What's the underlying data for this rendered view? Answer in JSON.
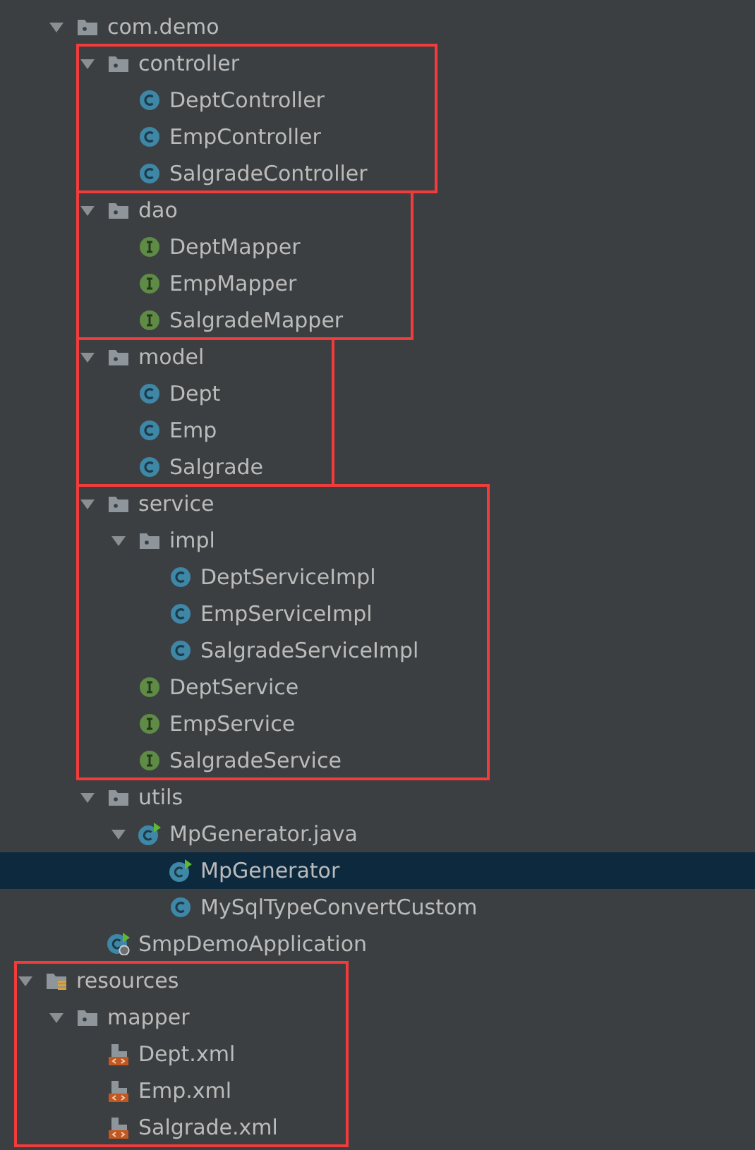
{
  "tree": {
    "continued": [
      {
        "label": "com.demo",
        "kind": "package",
        "expanded": true,
        "selected": false,
        "highlighted": false,
        "children": [
          {
            "label": "controller",
            "kind": "package",
            "expanded": true,
            "selected": false,
            "highlighted": true,
            "children": [
              {
                "label": "DeptController",
                "kind": "class",
                "selected": false
              },
              {
                "label": "EmpController",
                "kind": "class",
                "selected": false
              },
              {
                "label": "SalgradeController",
                "kind": "class",
                "selected": false
              }
            ]
          },
          {
            "label": "dao",
            "kind": "package",
            "expanded": true,
            "selected": false,
            "highlighted": true,
            "children": [
              {
                "label": "DeptMapper",
                "kind": "interface",
                "selected": false
              },
              {
                "label": "EmpMapper",
                "kind": "interface",
                "selected": false
              },
              {
                "label": "SalgradeMapper",
                "kind": "interface",
                "selected": false
              }
            ]
          },
          {
            "label": "model",
            "kind": "package",
            "expanded": true,
            "selected": false,
            "highlighted": true,
            "children": [
              {
                "label": "Dept",
                "kind": "class",
                "selected": false
              },
              {
                "label": "Emp",
                "kind": "class",
                "selected": false
              },
              {
                "label": "Salgrade",
                "kind": "class",
                "selected": false
              }
            ]
          },
          {
            "label": "service",
            "kind": "package",
            "expanded": true,
            "selected": false,
            "highlighted": true,
            "children": [
              {
                "label": "impl",
                "kind": "package",
                "expanded": true,
                "selected": false,
                "highlighted": false,
                "children": [
                  {
                    "label": "DeptServiceImpl",
                    "kind": "class",
                    "selected": false
                  },
                  {
                    "label": "EmpServiceImpl",
                    "kind": "class",
                    "selected": false
                  },
                  {
                    "label": "SalgradeServiceImpl",
                    "kind": "class",
                    "selected": false
                  }
                ]
              },
              {
                "label": "DeptService",
                "kind": "interface",
                "selected": false
              },
              {
                "label": "EmpService",
                "kind": "interface",
                "selected": false
              },
              {
                "label": "SalgradeService",
                "kind": "interface",
                "selected": false
              }
            ]
          },
          {
            "label": "utils",
            "kind": "package",
            "expanded": true,
            "selected": false,
            "highlighted": false,
            "children": [
              {
                "label": "MpGenerator.java",
                "kind": "runnable",
                "expanded": true,
                "selected": false,
                "highlighted": false,
                "children": [
                  {
                    "label": "MpGenerator",
                    "kind": "runnable",
                    "selected": true
                  },
                  {
                    "label": "MySqlTypeConvertCustom",
                    "kind": "class",
                    "selected": false
                  }
                ]
              }
            ]
          },
          {
            "label": "SmpDemoApplication",
            "kind": "app",
            "selected": false
          }
        ]
      }
    ],
    "items": [
      {
        "label": "resources",
        "kind": "resources",
        "expanded": true,
        "selected": false,
        "highlighted": true,
        "children": [
          {
            "label": "mapper",
            "kind": "package",
            "expanded": true,
            "selected": false,
            "highlighted": false,
            "children": [
              {
                "label": "Dept.xml",
                "kind": "xml",
                "selected": false
              },
              {
                "label": "Emp.xml",
                "kind": "xml",
                "selected": false
              },
              {
                "label": "Salgrade.xml",
                "kind": "xml",
                "selected": false
              }
            ]
          }
        ]
      }
    ]
  }
}
